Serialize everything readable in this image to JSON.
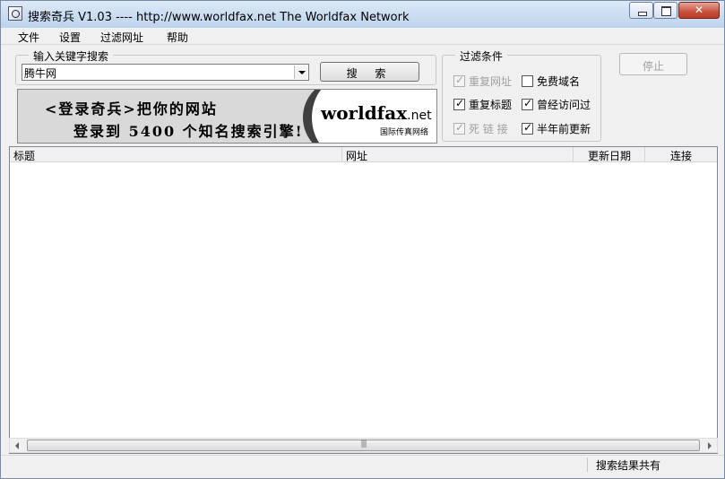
{
  "window": {
    "title": "搜索奇兵 V1.03  ----  http://www.worldfax.net  The Worldfax Network"
  },
  "menu": {
    "items": [
      "文件",
      "设置",
      "过滤网址",
      "帮助"
    ]
  },
  "search": {
    "legend": "输入关键字搜索",
    "value": "腾牛网",
    "button_label": "搜 索"
  },
  "banner": {
    "line1": "<登录奇兵>把你的网站",
    "line2": "登录到 5400 个知名搜索引擎!",
    "logo_world": "worldfax",
    "logo_net": ".net",
    "logo_sub": "国际传真网络"
  },
  "filter": {
    "legend": "过滤条件",
    "options": [
      {
        "label": "重复网址",
        "checked": true,
        "disabled": true
      },
      {
        "label": "免费域名",
        "checked": false,
        "disabled": false
      },
      {
        "label": "重复标题",
        "checked": true,
        "disabled": false
      },
      {
        "label": "曾经访问过",
        "checked": true,
        "disabled": false
      },
      {
        "label": "死 链 接",
        "checked": true,
        "disabled": true
      },
      {
        "label": "半年前更新",
        "checked": true,
        "disabled": false
      }
    ]
  },
  "stop_button": {
    "label": "停止"
  },
  "results": {
    "columns": [
      "标题",
      "网址",
      "更新日期",
      "连接"
    ],
    "rows": []
  },
  "status": {
    "text": "搜索结果共有"
  }
}
